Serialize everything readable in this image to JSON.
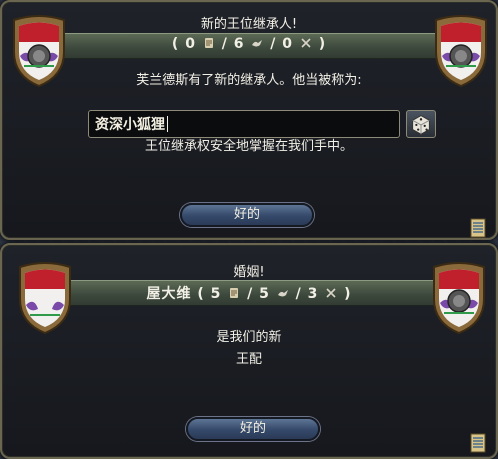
{
  "heir_panel": {
    "title": "新的王位继承人!",
    "stats_open": "(",
    "stat1": "0",
    "stat_sep1": "/",
    "stat2": "6",
    "stat_sep2": "/",
    "stat3": "0",
    "stats_close": ")",
    "message": "芙兰德斯有了新的继承人。他当被称为:",
    "name_value": "资深小狐狸",
    "footer": "王位继承权安全地掌握在我们手中。",
    "ok_label": "好的"
  },
  "marriage_panel": {
    "title": "婚姻!",
    "consort_name": "屋大维",
    "stats_open": "(",
    "stat1": "5",
    "stat_sep1": "/",
    "stat2": "5",
    "stat_sep2": "/",
    "stat3": "3",
    "stats_close": ")",
    "body_line1": "是我们的新",
    "body_line2": "王配",
    "ok_label": "好的"
  },
  "colors": {
    "accent_gold": "#6b6650",
    "banner_green": "#4a5a4a",
    "button_blue": "#3d5578",
    "shield_red": "#c0202c"
  },
  "icons": {
    "admin": "scroll-icon",
    "diplo": "dove-icon",
    "military": "crossed-swords-icon",
    "dice": "dice-icon",
    "ledger": "ledger-icon"
  }
}
